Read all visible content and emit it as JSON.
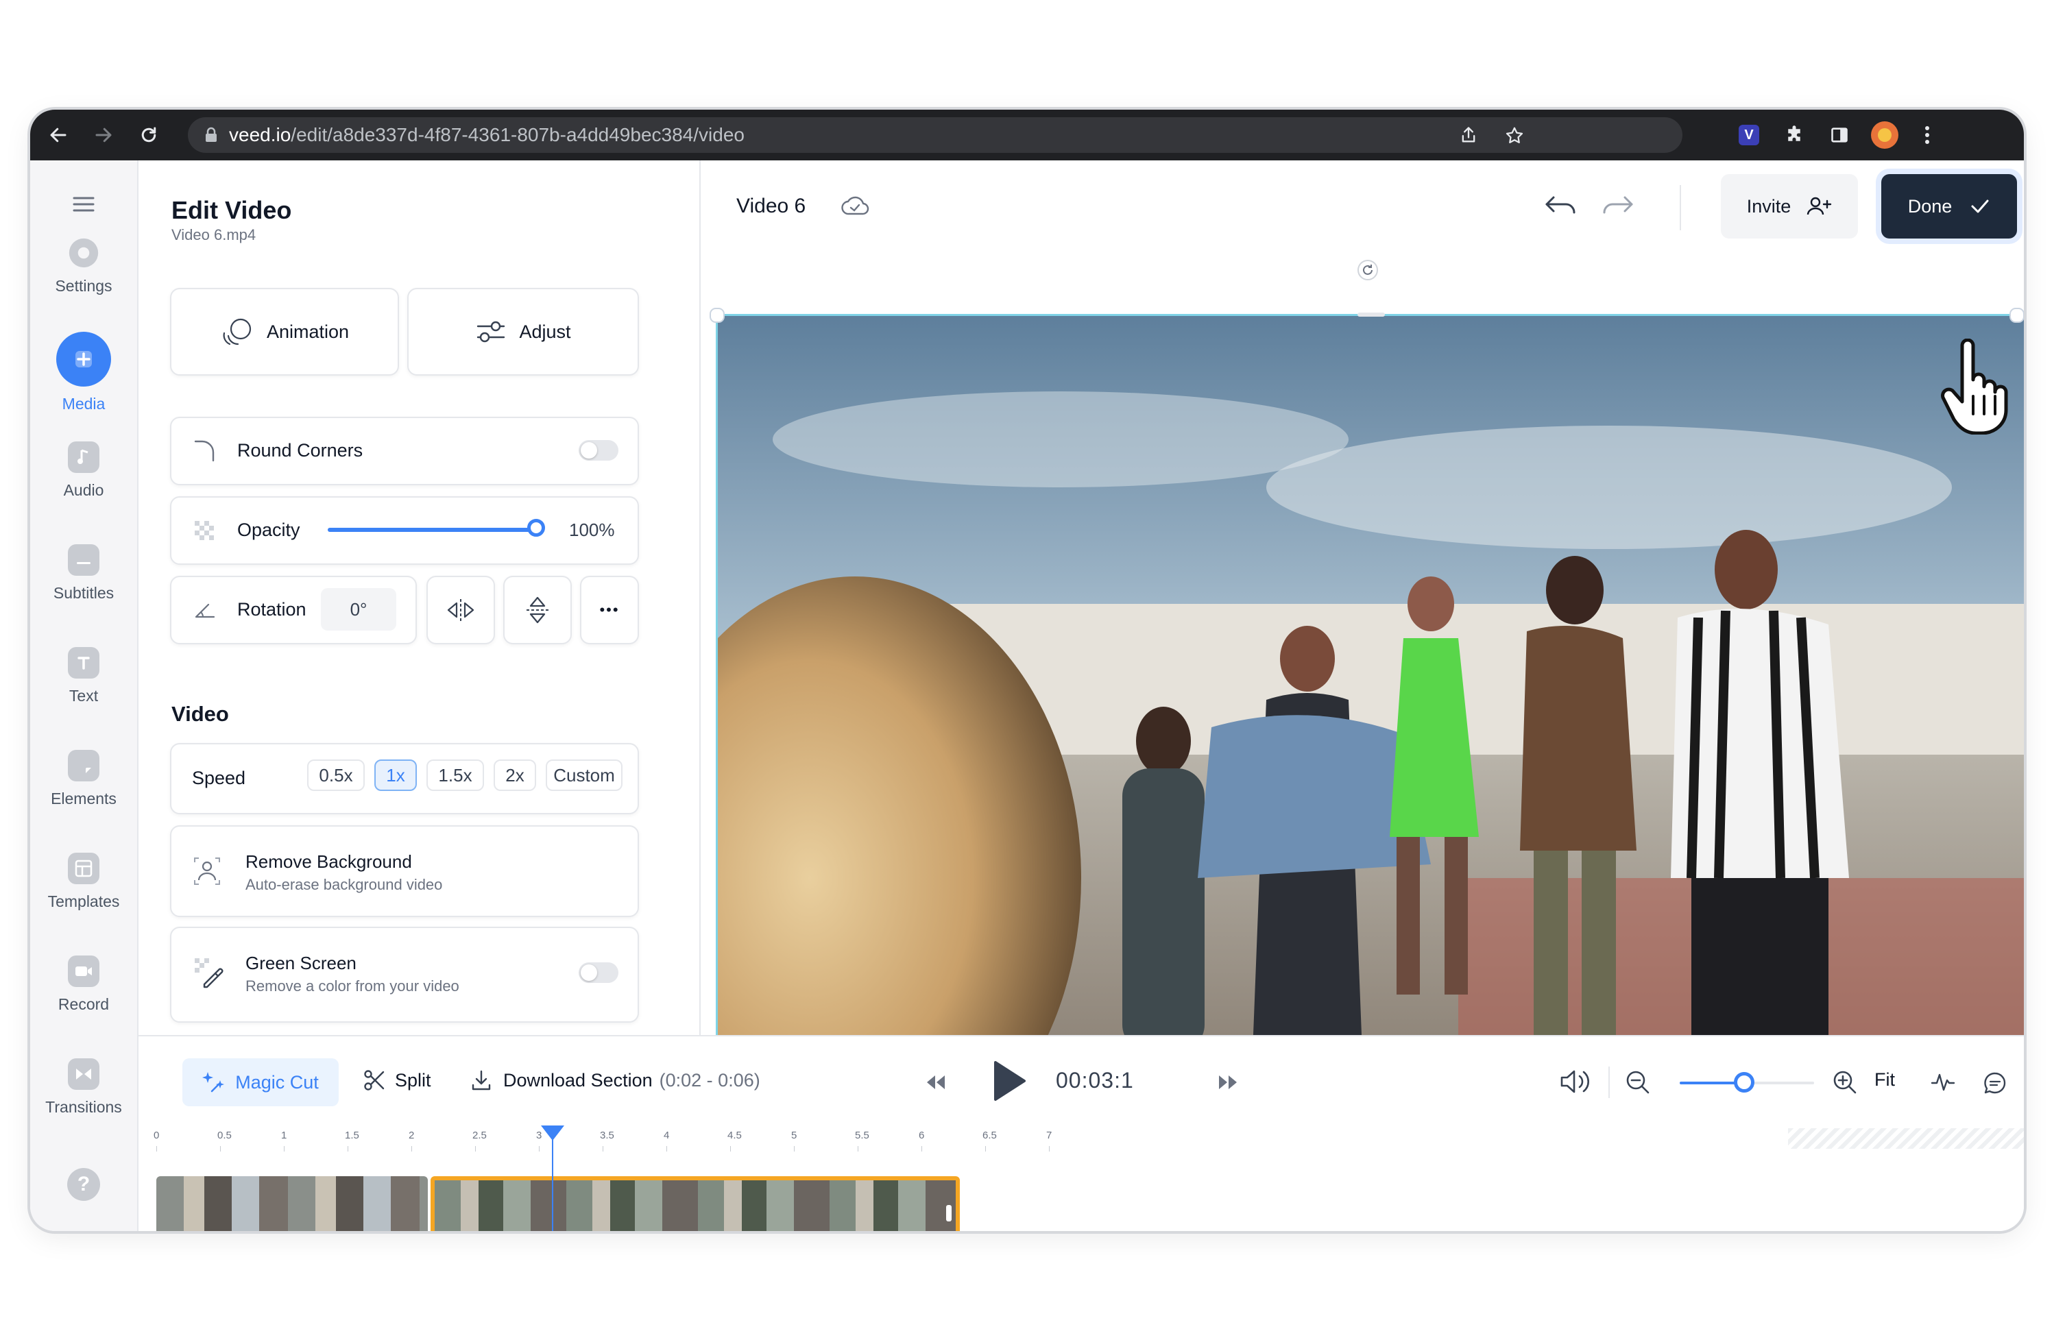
{
  "browser": {
    "url_host": "veed.io",
    "url_path": "/edit/a8de337d-4f87-4361-807b-a4dd49bec384/video"
  },
  "sidebar": {
    "items": [
      {
        "label": "Settings",
        "icon": "settings-icon"
      },
      {
        "label": "Media",
        "icon": "plus-icon"
      },
      {
        "label": "Audio",
        "icon": "music-note-icon"
      },
      {
        "label": "Subtitles",
        "icon": "subtitles-icon"
      },
      {
        "label": "Text",
        "icon": "text-icon"
      },
      {
        "label": "Elements",
        "icon": "elements-icon"
      },
      {
        "label": "Templates",
        "icon": "templates-icon"
      },
      {
        "label": "Record",
        "icon": "record-icon"
      },
      {
        "label": "Transitions",
        "icon": "transitions-icon"
      }
    ],
    "active": "Media",
    "help_symbol": "?"
  },
  "panel": {
    "title": "Edit Video",
    "subtitle": "Video 6.mp4",
    "animation_label": "Animation",
    "adjust_label": "Adjust",
    "round_corners_label": "Round Corners",
    "round_corners_on": false,
    "opacity_label": "Opacity",
    "opacity_value": "100%",
    "opacity_fraction": 1.0,
    "rotation_label": "Rotation",
    "rotation_value": "0°",
    "more_symbol": "•••",
    "video_section_title": "Video",
    "speed_label": "Speed",
    "speed_options": [
      "0.5x",
      "1x",
      "1.5x",
      "2x",
      "Custom"
    ],
    "speed_selected": "1x",
    "remove_bg_title": "Remove Background",
    "remove_bg_sub": "Auto-erase background video",
    "green_screen_title": "Green Screen",
    "green_screen_sub": "Remove a color from your video",
    "green_screen_on": false
  },
  "topbar": {
    "project_name": "Video 6",
    "invite_label": "Invite",
    "done_label": "Done"
  },
  "timeline": {
    "magic_cut_label": "Magic Cut",
    "split_label": "Split",
    "download_label": "Download Section",
    "download_range": "(0:02 - 0:06)",
    "time": "00:03:1",
    "fit_label": "Fit",
    "ruler": [
      "0",
      "0.5",
      "1",
      "1.5",
      "2",
      "2.5",
      "3",
      "3.5",
      "4",
      "4.5",
      "5",
      "5.5",
      "6",
      "6.5",
      "7"
    ],
    "playhead_seconds": 3.1,
    "zoom_fraction": 0.48,
    "clip1": {
      "start": 0,
      "end": 2.15
    },
    "clip2": {
      "start": 2.15,
      "end": 6.3,
      "selected": true
    },
    "accent_color": "#f5a623",
    "playhead_color": "#3b82f6"
  },
  "colors": {
    "primary": "#3b82f6",
    "done_bg": "#1e2a3b"
  }
}
